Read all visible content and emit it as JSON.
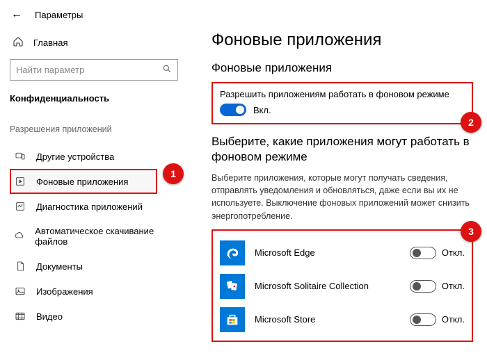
{
  "header": {
    "title": "Параметры"
  },
  "sidebar": {
    "home_label": "Главная",
    "search_placeholder": "Найти параметр",
    "category": "Конфиденциальность",
    "permissions_header": "Разрешения приложений",
    "items": [
      {
        "label": "Другие устройства"
      },
      {
        "label": "Фоновые приложения"
      },
      {
        "label": "Диагностика приложений"
      },
      {
        "label": "Автоматическое скачивание файлов"
      },
      {
        "label": "Документы"
      },
      {
        "label": "Изображения"
      },
      {
        "label": "Видео"
      }
    ]
  },
  "main": {
    "title": "Фоновые приложения",
    "section1_title": "Фоновые приложения",
    "allow_label": "Разрешить приложениям работать в фоновом режиме",
    "allow_state": "Вкл.",
    "section2_title": "Выберите, какие приложения могут работать в фоновом режиме",
    "section2_desc": "Выберите приложения, которые могут получать сведения, отправлять уведомления и обновляться, даже если вы их не используете. Выключение фоновых приложений может снизить энергопотребление.",
    "off_label": "Откл.",
    "apps": [
      {
        "name": "Microsoft Edge"
      },
      {
        "name": "Microsoft Solitaire Collection"
      },
      {
        "name": "Microsoft Store"
      }
    ]
  },
  "annotations": {
    "a1": "1",
    "a2": "2",
    "a3": "3"
  }
}
